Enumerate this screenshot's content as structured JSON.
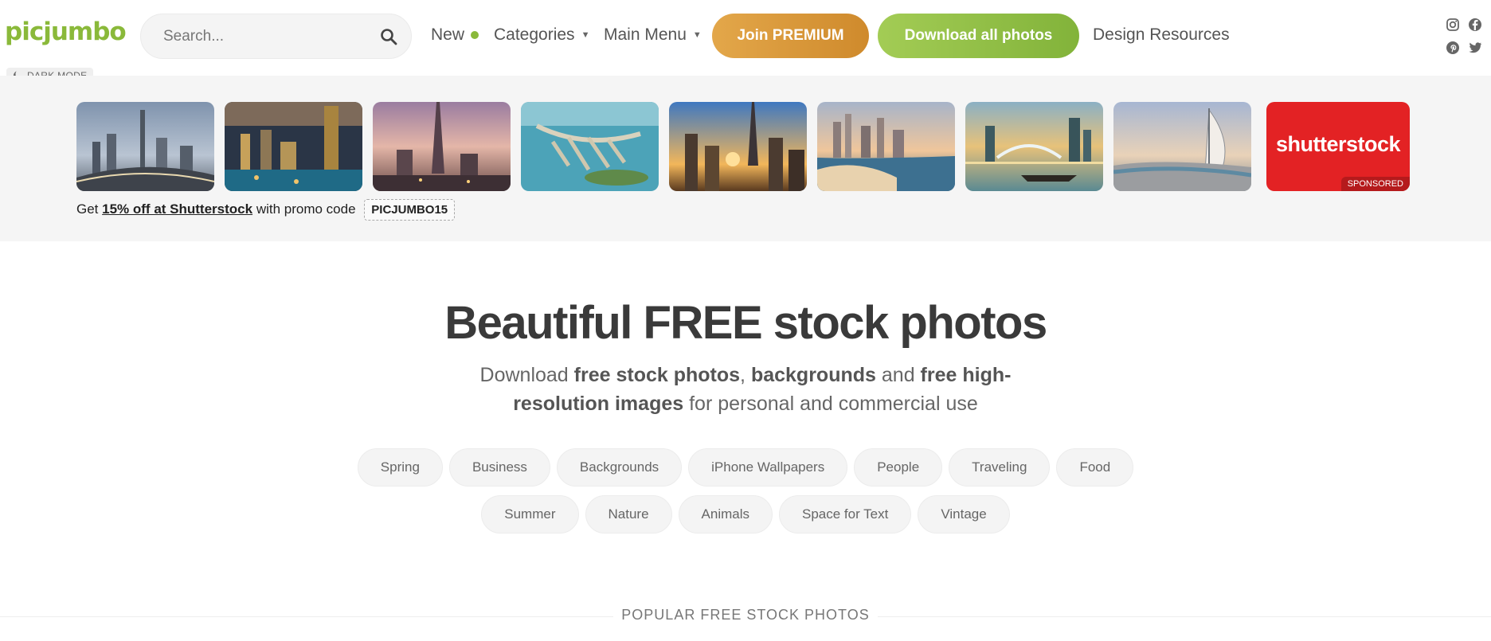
{
  "header": {
    "logo": "picjumbo",
    "search_placeholder": "Search...",
    "nav": {
      "new": "New",
      "categories": "Categories",
      "main_menu": "Main Menu",
      "design_resources": "Design Resources"
    },
    "join_premium": "Join PREMIUM",
    "download_all": "Download all photos",
    "dark_mode": "DARK MODE",
    "social_icons": [
      "instagram-icon",
      "facebook-icon",
      "pinterest-icon",
      "twitter-icon"
    ]
  },
  "strip": {
    "thumbnails": [
      "dubai-highway-photo",
      "dubai-marina-night-photo",
      "burj-khalifa-sunset-photo",
      "palm-jumeirah-aerial-photo",
      "dubai-skyline-sunrise-photo",
      "dubai-beach-skyline-photo",
      "dubai-fountain-boat-photo",
      "burj-al-arab-photo"
    ],
    "sponsor_brand": "shutterstock",
    "sponsored_label": "SPONSORED",
    "promo_prefix": "Get",
    "promo_link": "15% off at Shutterstock",
    "promo_middle": "with promo code",
    "promo_code": "PICJUMBO15"
  },
  "hero": {
    "title": "Beautiful FREE stock photos",
    "sub_1": "Download ",
    "sub_2": "free stock photos",
    "sub_3": ", ",
    "sub_4": "backgrounds",
    "sub_5": " and ",
    "sub_6": "free high-resolution images",
    "sub_7": " for personal and commercial use"
  },
  "categories_row1": [
    "Spring",
    "Business",
    "Backgrounds",
    "iPhone Wallpapers",
    "People",
    "Traveling",
    "Food"
  ],
  "categories_row2": [
    "Summer",
    "Nature",
    "Animals",
    "Space for Text",
    "Vintage"
  ],
  "popular_heading": "POPULAR FREE STOCK PHOTOS",
  "colors": {
    "brand_green": "#8ab93a",
    "premium_orange": "#d9962f",
    "shutterstock_red": "#e32224"
  }
}
